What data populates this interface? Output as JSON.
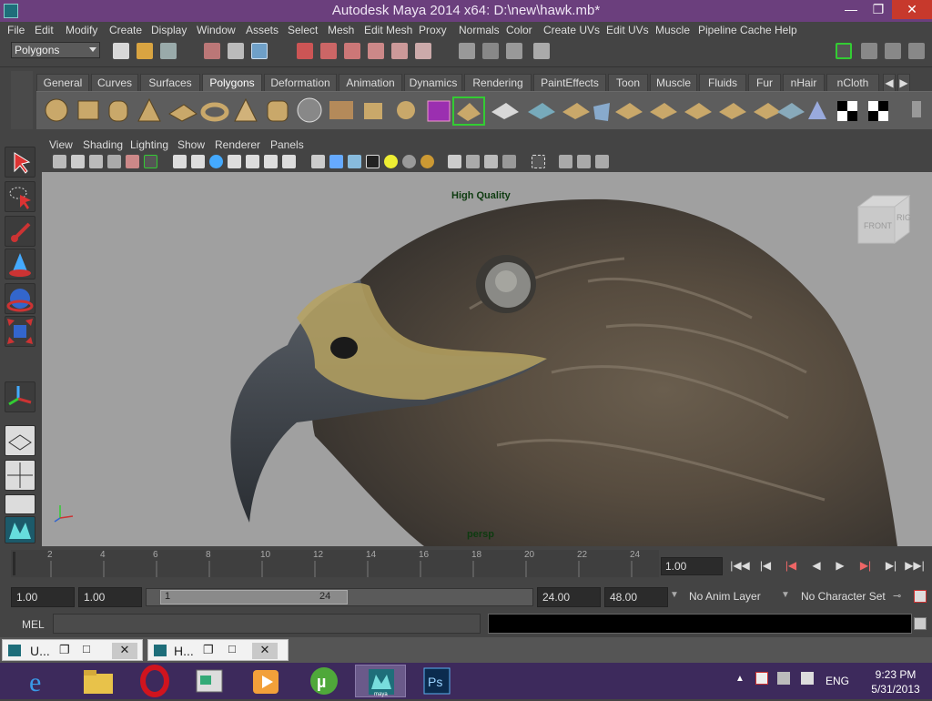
{
  "window": {
    "title": "Autodesk Maya 2014 x64: D:\\new\\hawk.mb*"
  },
  "menubar": [
    "File",
    "Edit",
    "Modify",
    "Create",
    "Display",
    "Window",
    "Assets",
    "Select",
    "Mesh",
    "Edit Mesh",
    "Proxy",
    "Normals",
    "Color",
    "Create UVs",
    "Edit UVs",
    "Muscle",
    "Pipeline Cache",
    "Help"
  ],
  "statusline": {
    "mode": "Polygons"
  },
  "shelf_tabs": [
    "General",
    "Curves",
    "Surfaces",
    "Polygons",
    "Deformation",
    "Animation",
    "Dynamics",
    "Rendering",
    "PaintEffects",
    "Toon",
    "Muscle",
    "Fluids",
    "Fur",
    "nHair",
    "nCloth"
  ],
  "shelf_active_tab": "Polygons",
  "panel_menu": [
    "View",
    "Shading",
    "Lighting",
    "Show",
    "Renderer",
    "Panels"
  ],
  "viewport": {
    "quality_label": "High Quality",
    "camera_label": "persp",
    "viewcube_front": "FRONT",
    "viewcube_right": "RIGHT"
  },
  "time_slider": {
    "ticks": [
      "2",
      "4",
      "6",
      "8",
      "10",
      "12",
      "14",
      "16",
      "18",
      "20",
      "22",
      "24"
    ],
    "current_time": "1.00"
  },
  "range": {
    "start_time": "1.00",
    "playback_start": "1.00",
    "slider_start": "1",
    "slider_end": "24",
    "playback_end": "24.00",
    "end_time": "48.00",
    "anim_layer": "No Anim Layer",
    "character_set": "No Character Set"
  },
  "command_line": {
    "label": "MEL"
  },
  "minimized_windows": [
    {
      "label": "U..."
    },
    {
      "label": "H..."
    }
  ],
  "taskbar": {
    "lang": "ENG",
    "time": "9:23 PM",
    "date": "5/31/2013",
    "ps_label": "Ps",
    "maya_label": "maya"
  },
  "colors": {
    "title_bar": "#6b3f7d",
    "taskbar": "#3d2a5c",
    "viewport_bg": "#a0a0a0",
    "close_red": "#c7392c"
  }
}
